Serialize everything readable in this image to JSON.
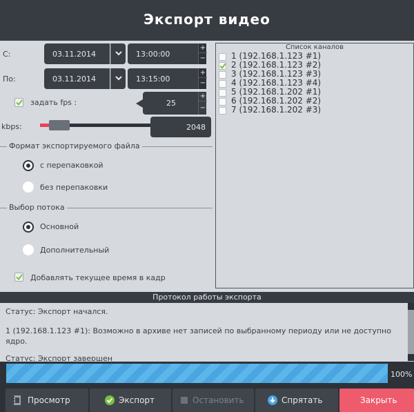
{
  "window": {
    "title": "Экспорт видео"
  },
  "from": {
    "label": "С:",
    "date": "03.11.2014",
    "time": "13:00:00"
  },
  "to": {
    "label": "По:",
    "date": "03.11.2014",
    "time": "13:15:00"
  },
  "fps": {
    "label": "задать fps :",
    "checked": true,
    "value": "25"
  },
  "kbps": {
    "label": "kbps:",
    "value": "2048",
    "slider_fraction": 0.1
  },
  "format_group": {
    "title": "Формат экспортируемого файла",
    "options": [
      {
        "label": "с перепаковкой",
        "selected": true
      },
      {
        "label": "без перепаковки",
        "selected": false
      }
    ]
  },
  "stream_group": {
    "title": "Выбор потока",
    "options": [
      {
        "label": "Основной",
        "selected": true
      },
      {
        "label": "Дополнительный",
        "selected": false
      }
    ]
  },
  "add_time": {
    "label": "Добавлять текущее время в кадр",
    "checked": true
  },
  "channels": {
    "title": "Список каналов",
    "items": [
      {
        "label": "1 (192.168.1.123 #1)",
        "checked": false
      },
      {
        "label": "2 (192.168.1.123 #2)",
        "checked": true
      },
      {
        "label": "3 (192.168.1.123 #3)",
        "checked": false
      },
      {
        "label": "4 (192.168.1.123 #4)",
        "checked": false
      },
      {
        "label": "5 (192.168.1.202 #1)",
        "checked": false
      },
      {
        "label": "6 (192.168.1.202 #2)",
        "checked": false
      },
      {
        "label": "7 (192.168.1.202 #3)",
        "checked": false
      }
    ]
  },
  "log": {
    "title": "Протокол работы экспорта",
    "lines": [
      "Статус: Экспорт начался.",
      "1 (192.168.1.123 #1): Возможно в архиве нет записей по выбранному периоду или не доступно ядро.",
      "Статус: Экспорт завершен"
    ]
  },
  "progress": {
    "value": 100,
    "text": "100%"
  },
  "buttons": {
    "view": "Просмотр",
    "export": "Экспорт",
    "stop": "Остановить",
    "hide": "Спрятать",
    "close": "Закрыть"
  },
  "colors": {
    "titlebar": "#373c43",
    "accent_blue": "#4aa6e0",
    "close_red": "#ee5b6c",
    "check_green": "#7ac142"
  },
  "icons": {
    "check": "check-icon",
    "dropdown": "chevron-down-icon",
    "view": "film-icon",
    "export": "check-circle-icon",
    "stop": "stop-square-icon",
    "hide": "download-circle-icon"
  }
}
